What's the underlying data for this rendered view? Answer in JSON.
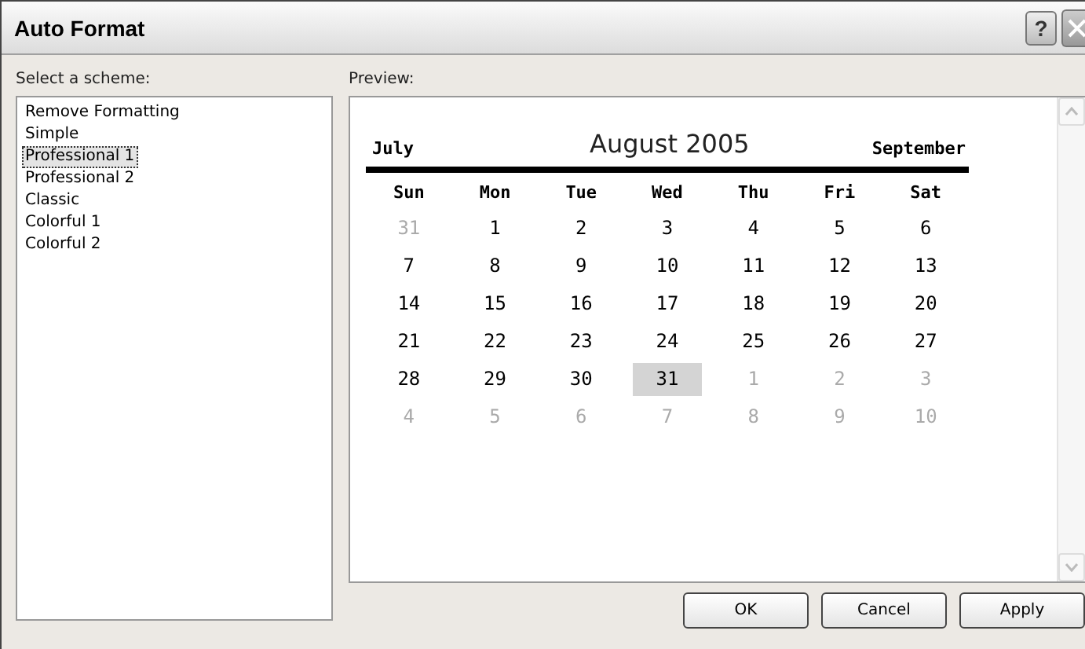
{
  "window": {
    "title": "Auto Format",
    "help": "?"
  },
  "scheme_label": "Select a scheme:",
  "schemes": [
    {
      "label": "Remove Formatting",
      "selected": false
    },
    {
      "label": "Simple",
      "selected": false
    },
    {
      "label": "Professional 1",
      "selected": true
    },
    {
      "label": "Professional 2",
      "selected": false
    },
    {
      "label": "Classic",
      "selected": false
    },
    {
      "label": "Colorful 1",
      "selected": false
    },
    {
      "label": "Colorful 2",
      "selected": false
    }
  ],
  "preview_label": "Preview:",
  "calendar": {
    "prev": "July",
    "title": "August 2005",
    "next": "September",
    "weekdays": [
      "Sun",
      "Mon",
      "Tue",
      "Wed",
      "Thu",
      "Fri",
      "Sat"
    ],
    "weeks": [
      [
        {
          "text": "31",
          "muted": true,
          "selected": false
        },
        {
          "text": "1",
          "muted": false,
          "selected": false
        },
        {
          "text": "2",
          "muted": false,
          "selected": false
        },
        {
          "text": "3",
          "muted": false,
          "selected": false
        },
        {
          "text": "4",
          "muted": false,
          "selected": false
        },
        {
          "text": "5",
          "muted": false,
          "selected": false
        },
        {
          "text": "6",
          "muted": false,
          "selected": false
        }
      ],
      [
        {
          "text": "7",
          "muted": false,
          "selected": false
        },
        {
          "text": "8",
          "muted": false,
          "selected": false
        },
        {
          "text": "9",
          "muted": false,
          "selected": false
        },
        {
          "text": "10",
          "muted": false,
          "selected": false
        },
        {
          "text": "11",
          "muted": false,
          "selected": false
        },
        {
          "text": "12",
          "muted": false,
          "selected": false
        },
        {
          "text": "13",
          "muted": false,
          "selected": false
        }
      ],
      [
        {
          "text": "14",
          "muted": false,
          "selected": false
        },
        {
          "text": "15",
          "muted": false,
          "selected": false
        },
        {
          "text": "16",
          "muted": false,
          "selected": false
        },
        {
          "text": "17",
          "muted": false,
          "selected": false
        },
        {
          "text": "18",
          "muted": false,
          "selected": false
        },
        {
          "text": "19",
          "muted": false,
          "selected": false
        },
        {
          "text": "20",
          "muted": false,
          "selected": false
        }
      ],
      [
        {
          "text": "21",
          "muted": false,
          "selected": false
        },
        {
          "text": "22",
          "muted": false,
          "selected": false
        },
        {
          "text": "23",
          "muted": false,
          "selected": false
        },
        {
          "text": "24",
          "muted": false,
          "selected": false
        },
        {
          "text": "25",
          "muted": false,
          "selected": false
        },
        {
          "text": "26",
          "muted": false,
          "selected": false
        },
        {
          "text": "27",
          "muted": false,
          "selected": false
        }
      ],
      [
        {
          "text": "28",
          "muted": false,
          "selected": false
        },
        {
          "text": "29",
          "muted": false,
          "selected": false
        },
        {
          "text": "30",
          "muted": false,
          "selected": false
        },
        {
          "text": "31",
          "muted": false,
          "selected": true
        },
        {
          "text": "1",
          "muted": true,
          "selected": false
        },
        {
          "text": "2",
          "muted": true,
          "selected": false
        },
        {
          "text": "3",
          "muted": true,
          "selected": false
        }
      ],
      [
        {
          "text": "4",
          "muted": true,
          "selected": false
        },
        {
          "text": "5",
          "muted": true,
          "selected": false
        },
        {
          "text": "6",
          "muted": true,
          "selected": false
        },
        {
          "text": "7",
          "muted": true,
          "selected": false
        },
        {
          "text": "8",
          "muted": true,
          "selected": false
        },
        {
          "text": "9",
          "muted": true,
          "selected": false
        },
        {
          "text": "10",
          "muted": true,
          "selected": false
        }
      ]
    ]
  },
  "buttons": [
    "OK",
    "Cancel",
    "Apply"
  ]
}
